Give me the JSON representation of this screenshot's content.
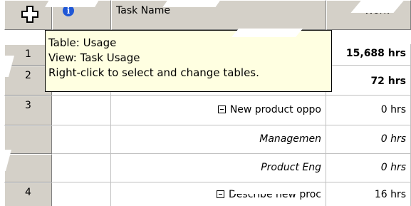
{
  "columns": {
    "task_name": "Task Name",
    "work": "Work"
  },
  "tooltip": {
    "line1": "Table: Usage",
    "line2": "View: Task Usage",
    "line3": "Right-click to select and change tables."
  },
  "rows": [
    {
      "id": "1",
      "name": "",
      "work": "15,688 hrs"
    },
    {
      "id": "2",
      "name": "",
      "work": "72 hrs"
    },
    {
      "id": "3",
      "name": "New product oppo",
      "work": "0 hrs"
    },
    {
      "id": "",
      "name": "Managemen",
      "work": "0 hrs"
    },
    {
      "id": "",
      "name": "Product Eng",
      "work": "0 hrs"
    },
    {
      "id": "4",
      "name": "Describe new proc",
      "work": "16 hrs"
    }
  ],
  "icons": {
    "select_all": "select-all-icon",
    "info": "info-icon",
    "collapse": "collapse-minus-icon"
  }
}
